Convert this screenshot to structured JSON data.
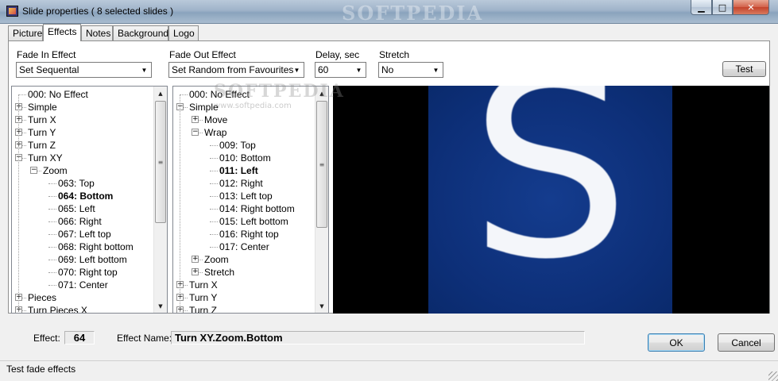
{
  "window": {
    "title": "Slide properties ( 8 selected slides )",
    "watermark": "SOFTPEDIA",
    "minimize_glyph": "▁",
    "maximize_glyph": "□",
    "close_glyph": "✕",
    "app_icon": "slideshow-app-icon"
  },
  "tabs": [
    {
      "label": "Picture"
    },
    {
      "label": "Effects",
      "active": true
    },
    {
      "label": "Notes"
    },
    {
      "label": "Background"
    },
    {
      "label": "Logo"
    }
  ],
  "fade_in": {
    "label": "Fade In Effect",
    "value": "Set Sequental"
  },
  "fade_out": {
    "label": "Fade Out Effect",
    "value": "Set Random from Favourites"
  },
  "delay": {
    "label": "Delay, sec",
    "value": "60"
  },
  "stretch": {
    "label": "Stretch",
    "value": "No"
  },
  "test_button": "Test",
  "tree_left": [
    {
      "label": "000: No Effect",
      "level": 0,
      "expander": ""
    },
    {
      "label": "Simple",
      "level": 0,
      "expander": "+"
    },
    {
      "label": "Turn X",
      "level": 0,
      "expander": "+"
    },
    {
      "label": "Turn Y",
      "level": 0,
      "expander": "+"
    },
    {
      "label": "Turn Z",
      "level": 0,
      "expander": "+"
    },
    {
      "label": "Turn XY",
      "level": 0,
      "expander": "−"
    },
    {
      "label": "Zoom",
      "level": 1,
      "expander": "−"
    },
    {
      "label": "063: Top",
      "level": 2,
      "expander": ""
    },
    {
      "label": "064: Bottom",
      "level": 2,
      "expander": "",
      "bold": true
    },
    {
      "label": "065: Left",
      "level": 2,
      "expander": ""
    },
    {
      "label": "066: Right",
      "level": 2,
      "expander": ""
    },
    {
      "label": "067: Left top",
      "level": 2,
      "expander": ""
    },
    {
      "label": "068: Right bottom",
      "level": 2,
      "expander": ""
    },
    {
      "label": "069: Left bottom",
      "level": 2,
      "expander": ""
    },
    {
      "label": "070: Right top",
      "level": 2,
      "expander": ""
    },
    {
      "label": "071: Center",
      "level": 2,
      "expander": ""
    },
    {
      "label": "Pieces",
      "level": 0,
      "expander": "+"
    },
    {
      "label": "Turn Pieces X",
      "level": 0,
      "expander": "+"
    }
  ],
  "tree_right": [
    {
      "label": "000: No Effect",
      "level": 0,
      "expander": ""
    },
    {
      "label": "Simple",
      "level": 0,
      "expander": "−"
    },
    {
      "label": "Move",
      "level": 1,
      "expander": "+"
    },
    {
      "label": "Wrap",
      "level": 1,
      "expander": "−"
    },
    {
      "label": "009: Top",
      "level": 2,
      "expander": ""
    },
    {
      "label": "010: Bottom",
      "level": 2,
      "expander": ""
    },
    {
      "label": "011: Left",
      "level": 2,
      "expander": "",
      "bold": true
    },
    {
      "label": "012: Right",
      "level": 2,
      "expander": ""
    },
    {
      "label": "013: Left top",
      "level": 2,
      "expander": ""
    },
    {
      "label": "014: Right bottom",
      "level": 2,
      "expander": ""
    },
    {
      "label": "015: Left bottom",
      "level": 2,
      "expander": ""
    },
    {
      "label": "016: Right top",
      "level": 2,
      "expander": ""
    },
    {
      "label": "017: Center",
      "level": 2,
      "expander": ""
    },
    {
      "label": "Zoom",
      "level": 1,
      "expander": "+"
    },
    {
      "label": "Stretch",
      "level": 1,
      "expander": "+"
    },
    {
      "label": "Turn X",
      "level": 0,
      "expander": "+"
    },
    {
      "label": "Turn Y",
      "level": 0,
      "expander": "+"
    },
    {
      "label": "Turn Z",
      "level": 0,
      "expander": "+"
    }
  ],
  "preview": {
    "letter": "S",
    "watermark": "SOFTPEDIA",
    "watermark_url": "www.softpedia.com"
  },
  "effect": {
    "label": "Effect:",
    "value": "64"
  },
  "effect_name": {
    "label": "Effect Name:",
    "value": "Turn XY.Zoom.Bottom"
  },
  "ok_button": "OK",
  "cancel_button": "Cancel",
  "status": "Test fade effects",
  "dropdown_glyph": "▼",
  "scroll_up_glyph": "▲",
  "scroll_down_glyph": "▼",
  "scroll_grip_glyph": "≡"
}
